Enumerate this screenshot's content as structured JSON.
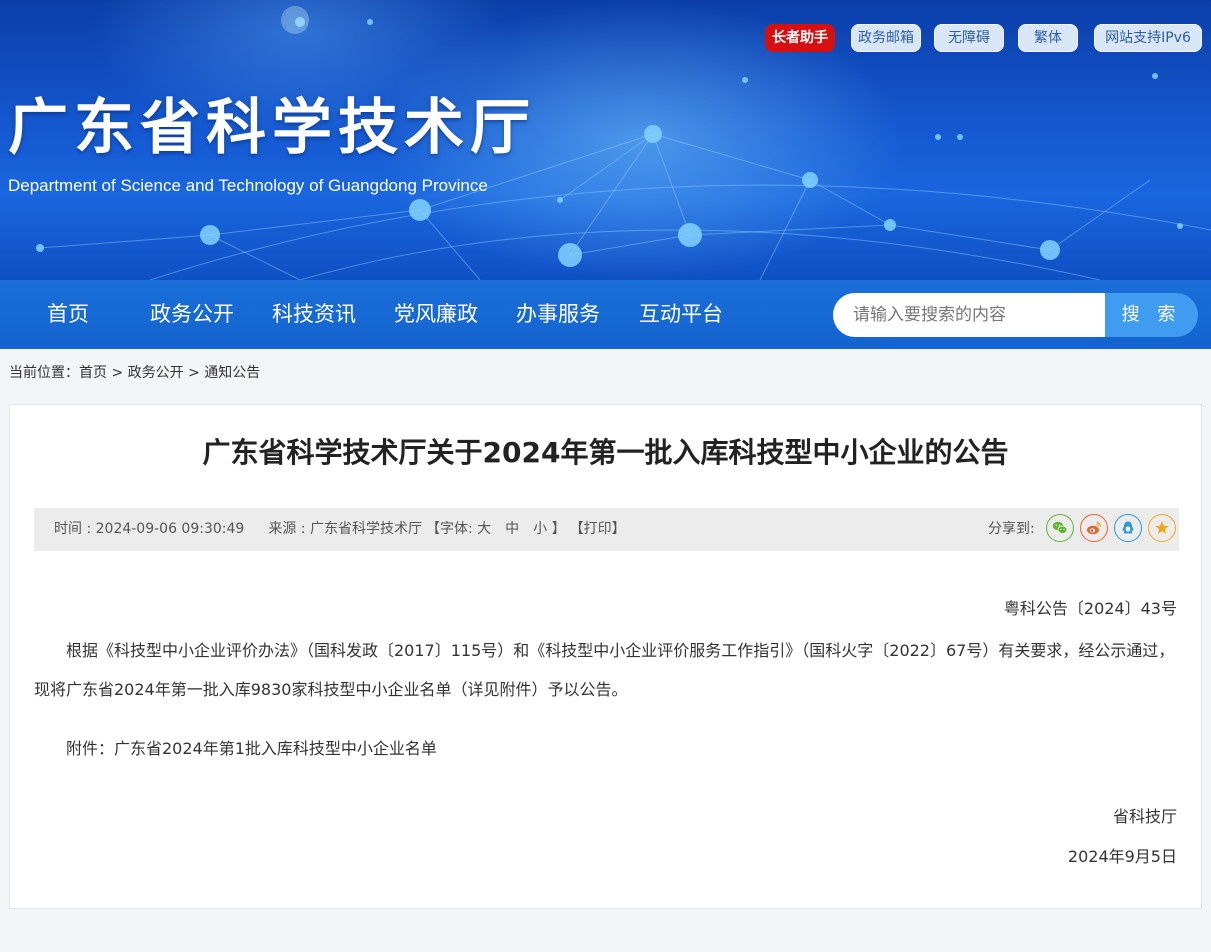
{
  "top_links": {
    "elder": "长者助手",
    "mailbox": "政务邮箱",
    "accessibility": "无障碍",
    "traditional": "繁体",
    "ipv6": "网站支持IPv6"
  },
  "header": {
    "title": "广东省科学技术厅",
    "subtitle": "Department of Science and Technology of Guangdong Province"
  },
  "nav": {
    "items": [
      "首页",
      "政务公开",
      "科技资讯",
      "党风廉政",
      "办事服务",
      "互动平台"
    ]
  },
  "search": {
    "placeholder": "请输入要搜索的内容",
    "button": "搜 索"
  },
  "breadcrumb": {
    "prefix": "当前位置：",
    "home": "首页",
    "sep": " > ",
    "level1": "政务公开",
    "level2": "通知公告"
  },
  "article": {
    "title": "广东省科学技术厅关于2024年第一批入库科技型中小企业的公告",
    "meta": {
      "time_label": "时间 : ",
      "time": "2024-09-06 09:30:49",
      "source_label": "来源 : ",
      "source": "广东省科学技术厅",
      "font_open": "【字体: ",
      "font_large": "大",
      "font_medium": "中",
      "font_small": "小",
      "font_close": " 】",
      "print": "【打印】",
      "share_label": "分享到:"
    },
    "doc_number": "粤科公告〔2024〕43号",
    "paragraph": "根据《科技型中小企业评价办法》（国科发政〔2017〕115号）和《科技型中小企业评价服务工作指引》（国科火字〔2022〕67号）有关要求，经公示通过，现将广东省2024年第一批入库9830家科技型中小企业名单（详见附件）予以公告。",
    "attachment": "附件：广东省2024年第1批入库科技型中小企业名单",
    "signature": "省科技厅",
    "date": "2024年9月5日"
  },
  "colors": {
    "banner_blue": "#1458d0",
    "nav_blue": "#1463cf",
    "search_button": "#3f9cf0",
    "elder_red": "#d70f10",
    "wechat": "#5cb531",
    "weibo": "#e8642d",
    "qq": "#2a9ad6",
    "favorite": "#f0a91c"
  }
}
